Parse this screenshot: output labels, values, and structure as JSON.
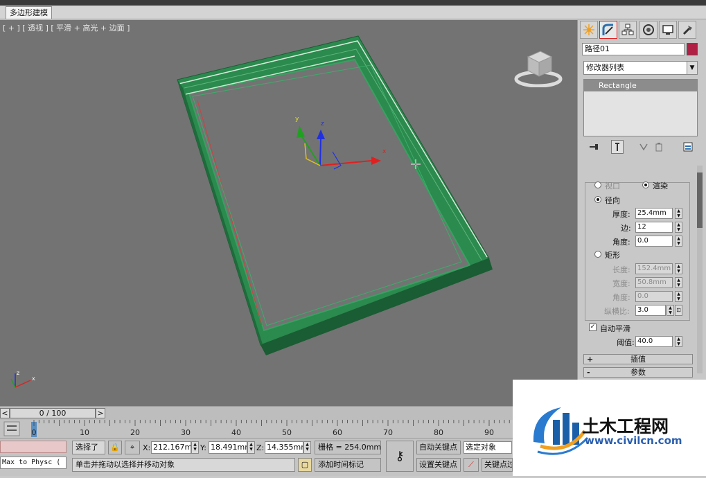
{
  "ribbon": {
    "tab_label": "多边形建模"
  },
  "viewport": {
    "label": "[ + ] [ 透视 ] [ 平滑 + 高光 + 边面 ]",
    "axis_x": "x",
    "axis_y": "y",
    "axis_z": "z"
  },
  "command_panel": {
    "tabs": [
      "create-icon",
      "modify-icon",
      "hierarchy-icon",
      "motion-icon",
      "display-icon",
      "utilities-icon"
    ],
    "object_name": "路径01",
    "object_color": "#b02045",
    "modifier_list": "修改器列表",
    "stack_item": "Rectangle",
    "rendering": {
      "viewport_label": "视口",
      "render_label": "渲染",
      "radial_label": "径向",
      "thickness_label": "厚度:",
      "thickness": "25.4mm",
      "sides_label": "边:",
      "sides": "12",
      "angle_label": "角度:",
      "angle": "0.0",
      "rect_label": "矩形",
      "length_label": "长度:",
      "length": "152.4mm",
      "width_label": "宽度:",
      "width": "50.8mm",
      "rect_angle_label": "角度:",
      "rect_angle": "0.0",
      "aspect_label": "纵横比:",
      "aspect": "3.0",
      "auto_smooth_label": "自动平滑",
      "threshold_label": "阈值:",
      "threshold": "40.0"
    },
    "rollout_interp": "插值",
    "rollout_params": "参数"
  },
  "timeline": {
    "frame_display": "0 / 100",
    "prev": "<",
    "next": ">",
    "ticks": [
      "0",
      "10",
      "20",
      "30",
      "40",
      "50",
      "60",
      "70",
      "80",
      "90"
    ]
  },
  "status": {
    "maxscript": "Max to Physc (",
    "selected": "选择了",
    "x_label": "X:",
    "x_value": "212.167mr",
    "y_label": "Y:",
    "y_value": "18.491mm",
    "z_label": "Z:",
    "z_value": "14.355mm",
    "grid": "栅格 = 254.0mm",
    "prompt": "单击并拖动以选择并移动对象",
    "add_time_tag": "添加时间标记",
    "auto_key": "自动关键点",
    "selection_set": "选定对象",
    "set_key": "设置关键点",
    "key_filters": "关键点过"
  },
  "watermark": {
    "brand": "土木工程网",
    "url": "www.civilcn.com"
  }
}
